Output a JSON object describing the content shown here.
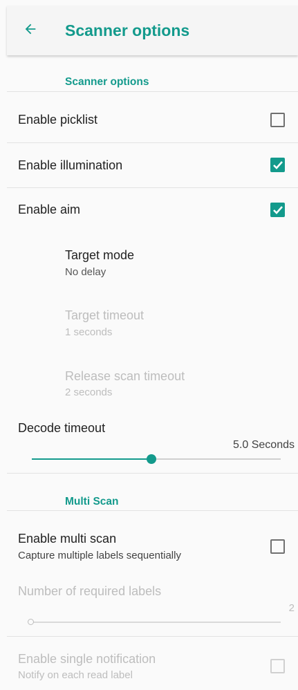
{
  "appbar": {
    "back_icon": "arrow-back-icon",
    "title": "Scanner options"
  },
  "colors": {
    "accent": "#139a8c",
    "disabled_text": "#bdbdbd",
    "background": "#fafafa"
  },
  "sections": {
    "scanner": {
      "header": "Scanner options",
      "enable_picklist": {
        "label": "Enable picklist",
        "checked": false
      },
      "enable_illumination": {
        "label": "Enable illumination",
        "checked": true
      },
      "enable_aim": {
        "label": "Enable aim",
        "checked": true
      },
      "target_mode": {
        "label": "Target mode",
        "value": "No delay",
        "enabled": true
      },
      "target_timeout": {
        "label": "Target timeout",
        "value": "1 seconds",
        "enabled": false
      },
      "release_scan_timeout": {
        "label": "Release scan timeout",
        "value": "2 seconds",
        "enabled": false
      },
      "decode_timeout": {
        "label": "Decode timeout",
        "value_text": "5.0 Seconds",
        "value": 5.0,
        "fraction": 0.48
      }
    },
    "multi_scan": {
      "header": "Multi Scan",
      "enable_multi_scan": {
        "label": "Enable multi scan",
        "summary": "Capture multiple labels sequentially",
        "checked": false
      },
      "required_labels": {
        "label": "Number of required labels",
        "value_text": "2",
        "value": 2,
        "fraction": 0.0,
        "enabled": false
      },
      "single_notification": {
        "label": "Enable single notification",
        "summary": "Notify on each read label",
        "checked": false,
        "enabled": false
      }
    }
  }
}
